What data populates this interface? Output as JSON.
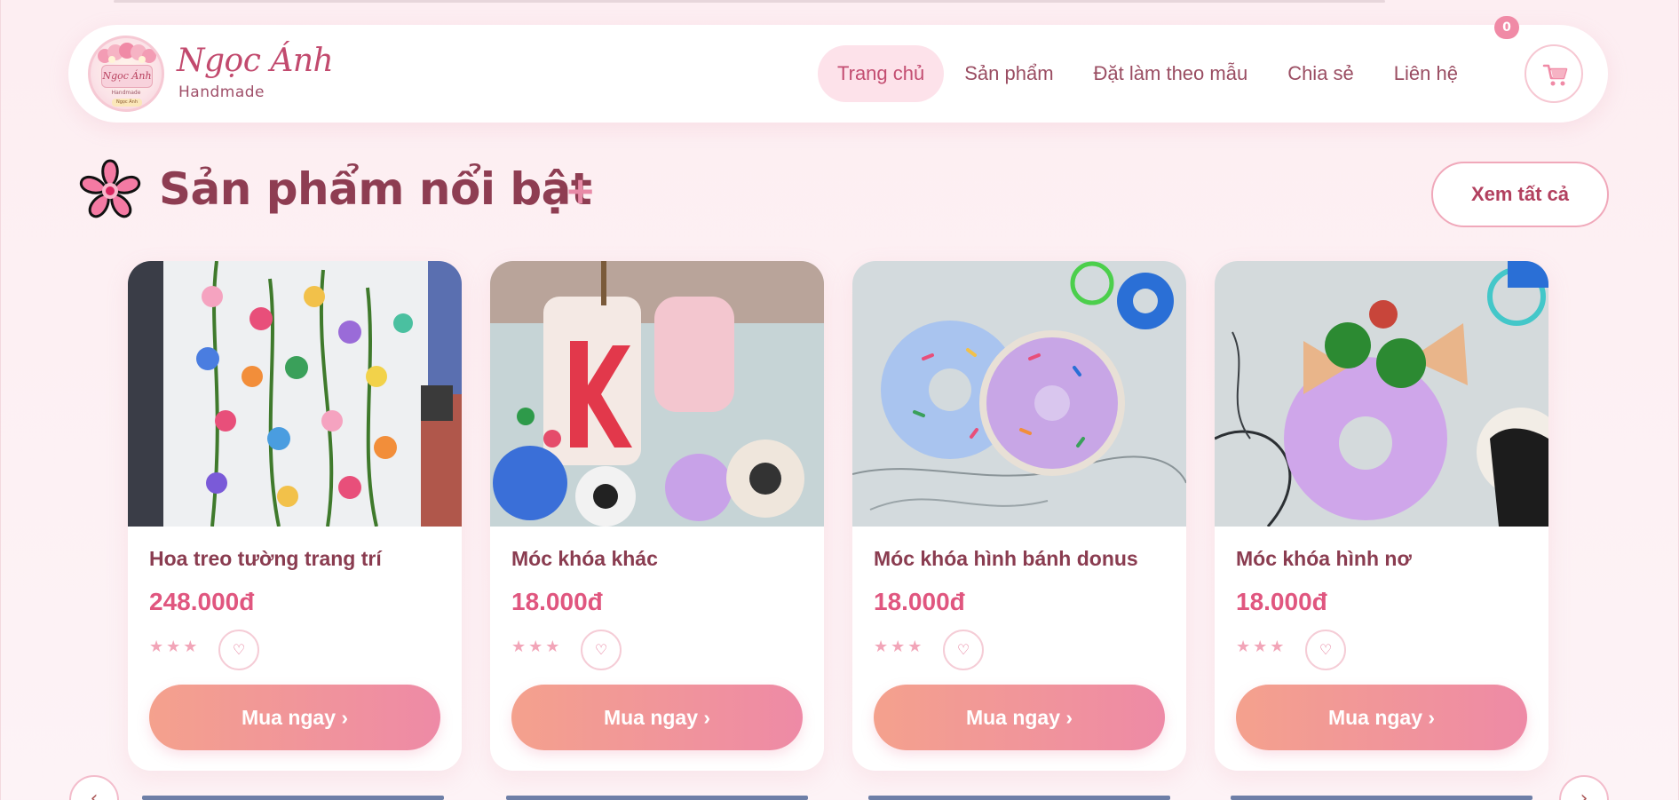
{
  "brand": {
    "name": "Ngọc Ánh",
    "subtitle": "Handmade",
    "logo_text": "Ngọc Ánh",
    "logo_sub": "Handmade",
    "logo_tag": "Ngọc Ánh"
  },
  "nav": {
    "items": [
      {
        "label": "Trang chủ",
        "active": true
      },
      {
        "label": "Sản phẩm",
        "active": false
      },
      {
        "label": "Đặt làm theo mẫu",
        "active": false
      },
      {
        "label": "Chia sẻ",
        "active": false
      },
      {
        "label": "Liên hệ",
        "active": false
      }
    ]
  },
  "cart": {
    "count": "0",
    "icon": "cart-icon"
  },
  "section": {
    "title": "Sản phẩm nổi bật",
    "plus": "+",
    "see_all": "Xem tất cả",
    "icon": "sakura-flower-icon"
  },
  "products": [
    {
      "name": "Hoa treo tường trang trí",
      "price": "248.000đ",
      "stars": "★★★",
      "buy": "Mua ngay ›",
      "photo": "pipe-cleaner-flower-wall-hanging"
    },
    {
      "name": "Móc khóa khác",
      "price": "18.000đ",
      "stars": "★★★",
      "buy": "Mua ngay ›",
      "photo": "assorted-keychains"
    },
    {
      "name": "Móc khóa hình bánh donus",
      "price": "18.000đ",
      "stars": "★★★",
      "buy": "Mua ngay ›",
      "photo": "donut-keychains"
    },
    {
      "name": "Móc khóa hình nơ",
      "price": "18.000đ",
      "stars": "★★★",
      "buy": "Mua ngay ›",
      "photo": "bow-donut-keychain"
    }
  ],
  "carousel": {
    "prev": "‹",
    "next": "›"
  },
  "colors": {
    "accent": "#e0567f",
    "brand": "#c24a6e",
    "title": "#8e3d52",
    "active_nav_bg": "#fde2ea",
    "button_gradient_start": "#f4a18d",
    "button_gradient_end": "#ee8aa6",
    "background": "#fdeef2"
  }
}
